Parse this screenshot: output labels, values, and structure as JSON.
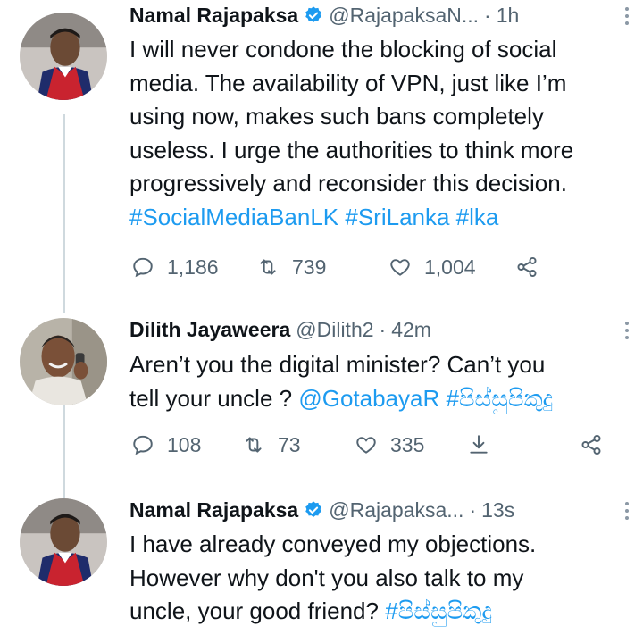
{
  "tweets": [
    {
      "name": "Namal Rajapaksa",
      "handle": "@RajapaksaN...",
      "time": "1h",
      "lines": [
        {
          "text": "I will never condone the blocking of social"
        },
        {
          "text": "media. The availability of VPN, just like I’m"
        },
        {
          "text": "using now, makes such bans completely"
        },
        {
          "text": "useless. I urge the authorities to think more"
        },
        {
          "text": "progressively and reconsider this decision."
        }
      ],
      "hashtags": "#SocialMediaBanLK #SriLanka #lka",
      "replies": "1,186",
      "retweets": "739",
      "likes": "1,004"
    },
    {
      "name": "Dilith Jayaweera",
      "handle": "@Dilith2",
      "time": "42m",
      "lines": [
        {
          "text": "Aren’t you the digital minister? Can’t you"
        }
      ],
      "line2_text": "tell your uncle ? ",
      "line2_tags": "@GotabayaR #පිස්සුපිකුදු",
      "replies": "108",
      "retweets": "73",
      "likes": "335"
    },
    {
      "name": "Namal Rajapaksa",
      "handle": "@Rajapaksa...",
      "time": "13s",
      "lines": [
        {
          "text": "I have already conveyed my objections."
        },
        {
          "text": "However why don't you also talk to my"
        }
      ],
      "line3_text": "uncle, your good friend? ",
      "line3_tags": "#පිස්සුපිකුදු"
    }
  ],
  "icons": {
    "reply": "reply-icon",
    "retweet": "retweet-icon",
    "like": "heart-icon",
    "share": "share-icon",
    "download": "download-icon",
    "verified": "verified-badge-icon"
  },
  "colors": {
    "link": "#1d9bf0",
    "muted": "#536471",
    "text": "#0f1419",
    "thread": "#cfd9de"
  }
}
